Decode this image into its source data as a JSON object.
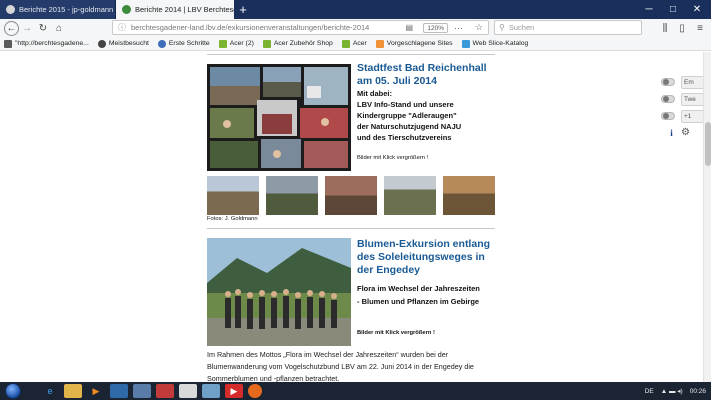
{
  "browser": {
    "tabs": [
      {
        "label": "Berichte 2015 - jp-goldmann",
        "active": false
      },
      {
        "label": "Berichte 2014 | LBV Berchtesga",
        "active": true
      }
    ],
    "url": "berchtesgadener-land.lbv.de/exkursionenveranstaltungen/berichte-2014",
    "zoom": "120%",
    "search_placeholder": "Suchen",
    "bookmarks": [
      {
        "label": "\"http://berchtesgadene...",
        "color": "#5a5a5a"
      },
      {
        "label": "Meistbesucht",
        "color": "#444444"
      },
      {
        "label": "Erste Schritte",
        "color": "#3f6db8"
      },
      {
        "label": "Acer (2)",
        "color": "#7bb431"
      },
      {
        "label": "Acer Zubehör Shop",
        "color": "#7bb431"
      },
      {
        "label": "Acer",
        "color": "#7bb431"
      },
      {
        "label": "Vorgeschlagene Sites",
        "color": "#f09236"
      },
      {
        "label": "Web Slice-Katalog",
        "color": "#3a9ad9"
      }
    ]
  },
  "article1": {
    "title": "Stadtfest Bad Reichenhall am 05. Juli 2014",
    "body_lines": [
      "Mit dabei:",
      "LBV Info-Stand und unsere",
      "Kindergruppe \"Adleraugen\"",
      "der Naturschutzjugend NAJU",
      "und des Tierschutzvereins"
    ],
    "enlarge": "Bilder mit Klick vergrößern !",
    "photo_credit": "Fotos: J. Goldmann"
  },
  "article2": {
    "title": "Blumen-Exkursion entlang des Soleleitungsweges in der Engedey",
    "body_lines": [
      "Flora im Wechsel der Jahreszeiten",
      "- Blumen und Pflanzen im Gebirge"
    ],
    "enlarge": "Bilder mit Klick vergrößern !",
    "paragraph_lines": [
      "Im Rahmen des Mottos „Flora im Wechsel der Jahreszeiten“ wurden bei der",
      "Blumenwanderung vom Vogelschutzbund LBV am 22. Juni 2014 in der Engedey die",
      "Sommerblumen und -pflanzen betrachtet."
    ]
  },
  "sidebar": {
    "share": [
      {
        "label": "Em"
      },
      {
        "label": "Twe"
      },
      {
        "label": "+1"
      }
    ]
  },
  "taskbar": {
    "lang": "DE",
    "time": "00:26"
  }
}
